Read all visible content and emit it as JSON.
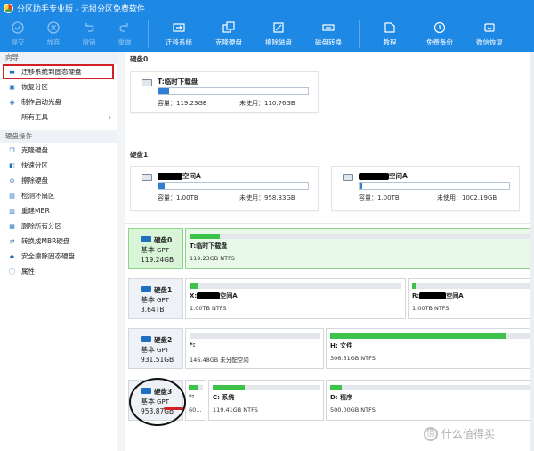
{
  "window": {
    "title": "分区助手专业版 - 无损分区免费软件"
  },
  "toolbar": {
    "left": [
      {
        "label": "提交",
        "icon": "check-icon"
      },
      {
        "label": "放弃",
        "icon": "cancel-icon"
      },
      {
        "label": "撤销",
        "icon": "undo-icon"
      },
      {
        "label": "重做",
        "icon": "redo-icon"
      }
    ],
    "middle": [
      {
        "label": "迁移系统",
        "icon": "migrate-icon"
      },
      {
        "label": "克隆硬盘",
        "icon": "clone-icon"
      },
      {
        "label": "擦除磁盘",
        "icon": "wipe-icon"
      },
      {
        "label": "磁盘转换",
        "icon": "convert-icon"
      }
    ],
    "right": [
      {
        "label": "教程",
        "icon": "tutorial-icon"
      },
      {
        "label": "免费备份",
        "icon": "backup-icon"
      },
      {
        "label": "微信恢复",
        "icon": "recover-icon"
      }
    ]
  },
  "sidebar": {
    "wizard_title": "向导",
    "wizard_items": [
      {
        "label": "迁移系统到固态硬盘"
      },
      {
        "label": "恢复分区"
      },
      {
        "label": "制作启动光盘"
      },
      {
        "label": "所有工具"
      }
    ],
    "ops_title": "硬盘操作",
    "ops_items": [
      {
        "label": "克隆硬盘"
      },
      {
        "label": "快速分区"
      },
      {
        "label": "擦除硬盘"
      },
      {
        "label": "检测坏扇区"
      },
      {
        "label": "重建MBR"
      },
      {
        "label": "删除所有分区"
      },
      {
        "label": "转换成MBR硬盘"
      },
      {
        "label": "安全擦除固态硬盘"
      },
      {
        "label": "属性"
      }
    ]
  },
  "overview": {
    "disk0": {
      "heading": "硬盘0",
      "partitions": [
        {
          "name": "T:临时下载盘",
          "capacity": "容量：119.23GB",
          "free": "未使用：110.76GB",
          "used_fraction": 0.07
        }
      ]
    },
    "disk1": {
      "heading": "硬盘1",
      "partitions": [
        {
          "name_suffix": "空间A",
          "capacity": "容量：1.00TB",
          "free": "未使用：958.33GB",
          "used_fraction": 0.04
        },
        {
          "name_suffix": "空间A",
          "capacity": "容量：1.00TB",
          "free": "未使用：1002.19GB",
          "used_fraction": 0.02
        }
      ]
    }
  },
  "diskmap": [
    {
      "name": "硬盘0",
      "type": "基本",
      "style": "GPT",
      "size": "119.24GB",
      "active": true,
      "segments": [
        {
          "name": "T:临时下载盘",
          "info": "119.23GB NTFS",
          "used_fraction": 0.09,
          "active": true
        }
      ]
    },
    {
      "name": "硬盘1",
      "type": "基本",
      "style": "GPT",
      "size": "3.64TB",
      "active": false,
      "segments": [
        {
          "prefix": "X:",
          "name_suffix": "空间A",
          "info": "1.00TB NTFS",
          "used_fraction": 0.04
        },
        {
          "prefix": "R:",
          "name_suffix": "空间A",
          "info": "1.00TB NTFS",
          "used_fraction": 0.03
        }
      ]
    },
    {
      "name": "硬盘2",
      "type": "基本",
      "style": "GPT",
      "size": "931.51GB",
      "active": false,
      "segments": [
        {
          "name": "*:",
          "info": "146.48GB 未分配空间",
          "used_fraction": 0
        },
        {
          "name": "H: 文件",
          "info": "306.51GB NTFS",
          "used_fraction": 0.88
        }
      ]
    },
    {
      "name": "硬盘3",
      "type": "基本",
      "style": "GPT",
      "size": "953.87GB",
      "active": false,
      "segments": [
        {
          "name": "*:",
          "info": "60...",
          "used_fraction": 0.6
        },
        {
          "name": "C: 系统",
          "info": "119.41GB NTFS",
          "used_fraction": 0.3
        },
        {
          "name": "D: 程序",
          "info": "500.00GB NTFS",
          "used_fraction": 0.06
        }
      ]
    }
  ],
  "watermark": {
    "text": "什么值得买"
  }
}
